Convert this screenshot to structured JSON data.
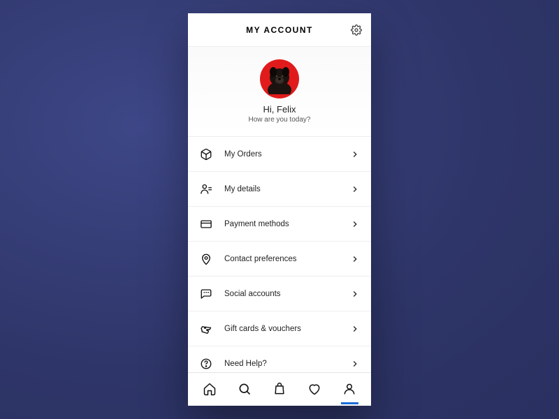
{
  "header": {
    "title": "MY ACCOUNT"
  },
  "profile": {
    "greeting": "Hi, Felix",
    "subgreeting": "How are you today?",
    "avatar_bg": "#e11b1b"
  },
  "menu": [
    {
      "icon": "box-icon",
      "label": "My Orders"
    },
    {
      "icon": "person-icon",
      "label": "My details"
    },
    {
      "icon": "card-icon",
      "label": "Payment methods"
    },
    {
      "icon": "pin-icon",
      "label": "Contact preferences"
    },
    {
      "icon": "chat-icon",
      "label": "Social accounts"
    },
    {
      "icon": "ticket-icon",
      "label": "Gift cards & vouchers"
    },
    {
      "icon": "help-icon",
      "label": "Need Help?"
    }
  ],
  "tabs": [
    {
      "icon": "home-icon",
      "active": false
    },
    {
      "icon": "search-icon",
      "active": false
    },
    {
      "icon": "bag-icon",
      "active": false
    },
    {
      "icon": "heart-icon",
      "active": false
    },
    {
      "icon": "account-icon",
      "active": true
    }
  ]
}
